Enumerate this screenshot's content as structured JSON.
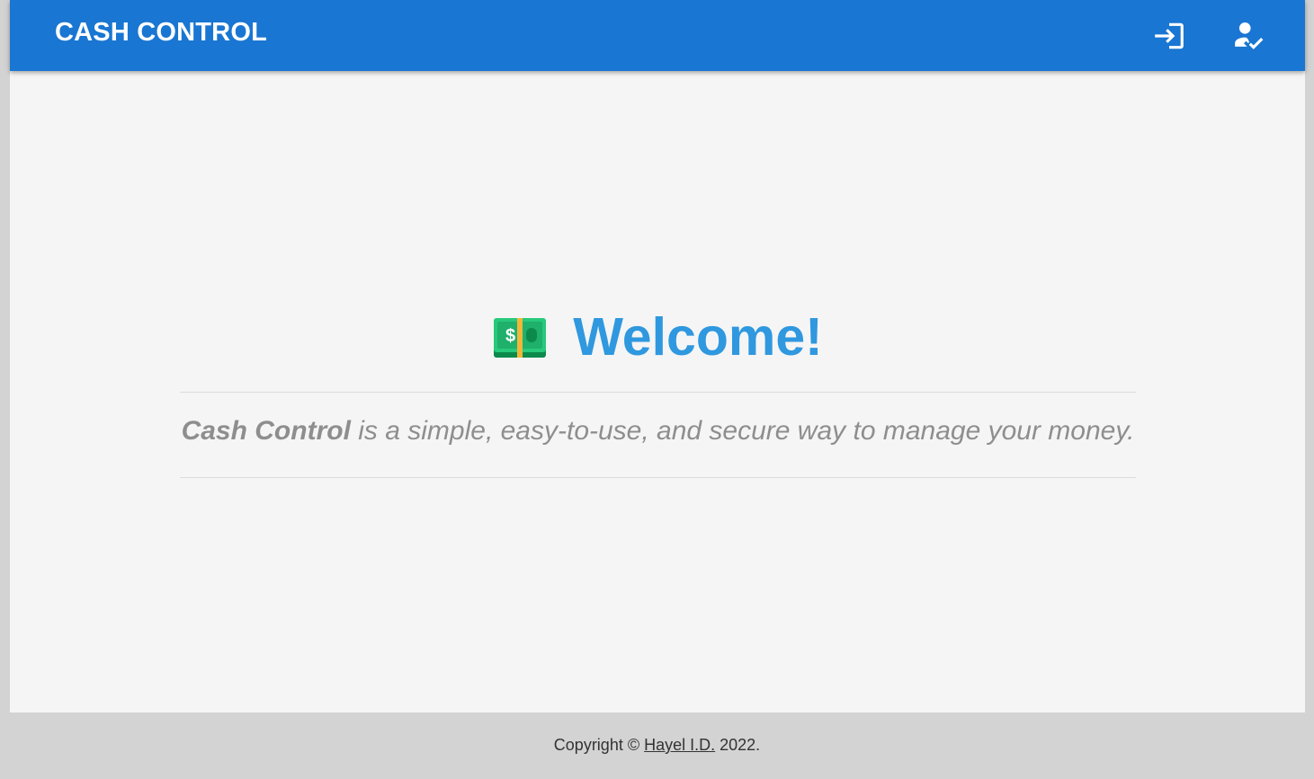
{
  "header": {
    "title": "CASH CONTROL",
    "icons": {
      "login": "login-icon",
      "register": "person-check-icon"
    },
    "color": "#1976d2"
  },
  "hero": {
    "emoji_icon": "money-banknote-icon",
    "title": "Welcome!",
    "title_color": "#2f98df"
  },
  "tagline": {
    "brand": "Cash Control",
    "text": " is a simple, easy-to-use, and secure way to manage your money."
  },
  "footer": {
    "prefix": "Copyright © ",
    "author": "Hayel I.D.",
    "suffix": " 2022."
  }
}
